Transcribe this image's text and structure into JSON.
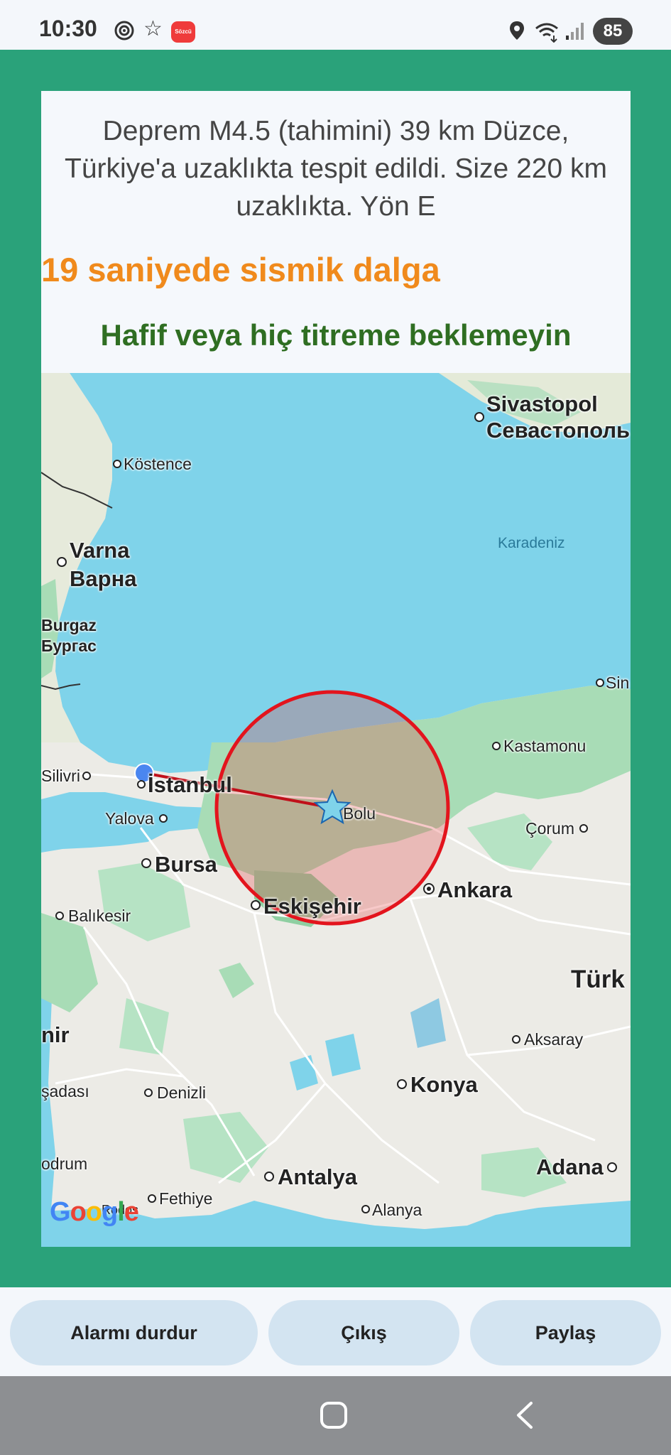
{
  "status_bar": {
    "time": "10:30",
    "battery": "85",
    "app_badge": "Sözcü",
    "icons": [
      "target-icon",
      "star-icon",
      "app-icon",
      "location-icon",
      "wifi-icon",
      "signal-icon",
      "battery-icon"
    ]
  },
  "alert": {
    "info": "Deprem M4.5 (tahimini) 39 km Düzce, Türkiye'a uzaklıkta tespit edildi. Size 220 km uzaklıkta. Yön E",
    "wave": "19 saniyede sismik dalga",
    "shake": "Hafif veya hiç titreme beklemeyin"
  },
  "map": {
    "labels": {
      "sivastopol": "Sivastopol",
      "sevastopol": "Севастополь",
      "kostence": "Köstence",
      "karadeniz": "Karadeniz",
      "varna": "Varna",
      "varna_cyr": "Варна",
      "burgaz": "Burgaz",
      "burgas_cyr": "Бургас",
      "sinop": "Sin",
      "kastamonu": "Kastamonu",
      "silivri": "Silivri",
      "istanbul": "İstanbul",
      "bolu": "Bolu",
      "yalova": "Yalova",
      "corum": "Çorum",
      "bursa": "Bursa",
      "ankara": "Ankara",
      "balikesir": "Balıkesir",
      "eskisehir": "Eskişehir",
      "turkiye": "Türk",
      "izmir": "nir",
      "aksaray": "Aksaray",
      "kusadasi": "şadası",
      "denizli": "Denizli",
      "konya": "Konya",
      "bodrum": "odrum",
      "antalya": "Antalya",
      "adana": "Adana",
      "fethiye": "Fethiye",
      "alanya": "Alanya",
      "rodos": "Rodos"
    },
    "logo": "Google",
    "colors": {
      "sea": "#7fd3ea",
      "land": "#ecebe6",
      "forest": "#a8dcb6",
      "impact_circle": "#e3141d",
      "user_location": "#4a86f0"
    }
  },
  "buttons": {
    "stop_alarm": "Alarmı durdur",
    "exit": "Çıkış",
    "share": "Paylaş"
  },
  "colors": {
    "frame": "#2aa27a",
    "wave_text": "#f08a1c",
    "shake_text": "#2f6e22",
    "button_bg": "#d3e4f1"
  }
}
